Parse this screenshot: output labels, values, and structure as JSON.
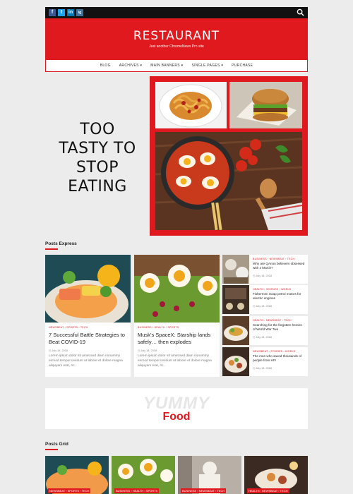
{
  "topbar": {
    "social": [
      "f",
      "t",
      "in",
      "ig"
    ],
    "social_colors": [
      "#3b5998",
      "#1da1f2",
      "#0077b5",
      "#3f729b"
    ]
  },
  "header": {
    "title": "RESTAURANT",
    "tagline": "Just another ChromeNews Pro site"
  },
  "nav": {
    "items": [
      "BLOG",
      "ARCHIVES ▾",
      "MAIN BANNERS ▾",
      "SINGLE PAGES ▾",
      "PURCHASE"
    ]
  },
  "hero": {
    "text_lines": [
      "TOO",
      "TASTY TO",
      "STOP",
      "EATING"
    ]
  },
  "posts_express": {
    "title": "Posts Express",
    "big": [
      {
        "cats": "NEWSBEAT  ›  SPORTS  ›  TECH",
        "title": "7 Successful Battle Strategies to Beat COVID-19",
        "date": "July 18, 2018",
        "excerpt": "Lorem ipsum dolor sit amet,sed diam nonummy eirmod tempor invidunt ut labore et dolore magna aliquyam erat, At..."
      },
      {
        "cats": "BUSINESS  ›  HEALTH  ›  SPORTS",
        "title": "Musk’s SpaceX: Starship lands safely… then explodes",
        "date": "July 18, 2018",
        "excerpt": "Lorem ipsum dolor sit amet,sed diam nonummy eirmod tempor invidunt ut labore et dolore magna aliquyam erat, At..."
      }
    ],
    "small": [
      {
        "cats": "BUSINESS  ›  NEWSBEAT  ›  TECH",
        "title": "Why are QAnon believers obsessed with 4 March?",
        "date": "July 18, 2018"
      },
      {
        "cats": "",
        "title": "Fishermen swap petrol motors for electric engines",
        "date": "July 18, 2018"
      },
      {
        "cats": "HEALTH  ›  NEWSBEAT  ›  TECH",
        "title": "Searching for the forgotten heroes of World War Two",
        "date": "July 18, 2018"
      },
      {
        "cats": "NEWSBEAT  ›  STORIES  ›  WORLD",
        "title": "The man who saved thousands of people from HIV",
        "date": "July 18, 2018"
      }
    ],
    "small_cats_bottom": "HEALTH  ›  SCIENCE  ›  WORLD"
  },
  "banner": {
    "bg_text": "YUMMY",
    "text": "Food"
  },
  "posts_grid": {
    "title": "Posts Grid",
    "tags": [
      "NEWSBEAT  ›  SPORTS  ›  TECH",
      "BUSINESS  ›  HEALTH  ›  SPORTS",
      "BUSINESS  ›  NEWSBEAT  ›  TECH",
      "HEALTH  ›  NEWSBEAT  ›  TECH"
    ]
  },
  "colors": {
    "accent": "#e0191e",
    "topbar": "#111111"
  }
}
